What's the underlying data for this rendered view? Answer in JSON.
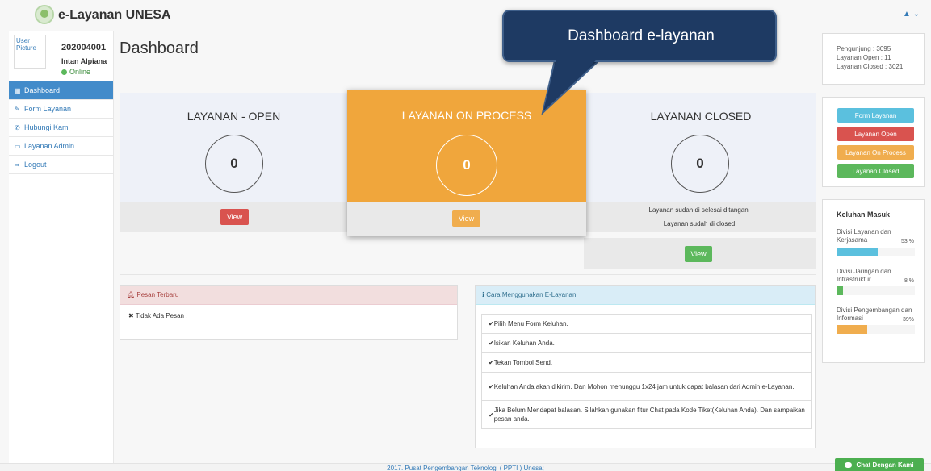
{
  "header": {
    "app_title": "e-Layanan UNESA",
    "user_menu": "▲ ⌄"
  },
  "sidebar": {
    "user_pic_alt": "User Picture",
    "user_id": "202004001",
    "user_name": "Intan Alpiana",
    "status": "Online",
    "items": [
      {
        "icon": "table-icon",
        "glyph": "▦",
        "label": "Dashboard",
        "active": true
      },
      {
        "icon": "pencil-icon",
        "glyph": "✎",
        "label": "Form Layanan"
      },
      {
        "icon": "phone-icon",
        "glyph": "✆",
        "label": "Hubungi Kami"
      },
      {
        "icon": "laptop-icon",
        "glyph": "▭",
        "label": "Layanan Admin"
      },
      {
        "icon": "logout-icon",
        "glyph": "➥",
        "label": "Logout"
      }
    ]
  },
  "main": {
    "page_title": "Dashboard",
    "stats": {
      "open": {
        "title": "LAYANAN - OPEN",
        "count": "0",
        "button": "View"
      },
      "process": {
        "title": "LAYANAN ON PROCESS",
        "count": "0",
        "button": "View"
      },
      "closed": {
        "title": "LAYANAN CLOSED",
        "count": "0",
        "button": "View",
        "note1": "Layanan sudah di selesai ditangani",
        "note2": "Layanan sudah di closed"
      }
    },
    "pesan": {
      "title": "Pesan Terbaru",
      "icon": "bell-icon",
      "empty_text": "Tidak Ada Pesan !"
    },
    "cara": {
      "title": "Cara Menggunakan E-Layanan",
      "icon": "info-icon",
      "steps": [
        "Pilih Menu Form Keluhan.",
        "Isikan Keluhan Anda.",
        "Tekan Tombol Send.",
        "Keluhan Anda akan dikirim. Dan Mohon menunggu 1x24 jam untuk dapat balasan dari Admin e-Layanan.",
        "Jika Belum Mendapat balasan. Silahkan gunakan fitur Chat pada Kode Tiket(Keluhan Anda). Dan sampaikan pesan anda."
      ]
    }
  },
  "right": {
    "info": [
      "Pengunjung : 3095",
      "Layanan Open : 11",
      "Layanan Closed : 3021"
    ],
    "buttons": [
      {
        "label": "Form Layanan",
        "style": "cyan"
      },
      {
        "label": "Layanan Open",
        "style": "red"
      },
      {
        "label": "Layanan On Process",
        "style": "orange"
      },
      {
        "label": "Layanan Closed",
        "style": "green"
      }
    ],
    "keluhan": {
      "title": "Keluhan Masuk",
      "items": [
        {
          "label": "Divisi Layanan dan Kerjasama",
          "percent_text": "53 %",
          "value": 53,
          "color": "#5bc0de"
        },
        {
          "label": "Divisi Jaringan dan Infrastruktur",
          "percent_text": "8 %",
          "value": 8,
          "color": "#5cb85c"
        },
        {
          "label": "Divisi Pengembangan dan Informasi",
          "percent_text": "39%",
          "value": 39,
          "color": "#f0ad4e"
        }
      ]
    }
  },
  "footer": {
    "text": "2017. Pusat Pengembangan Teknologi ( PPTI ) Unesa;",
    "chat_label": "Chat Dengan Kami"
  },
  "callout": {
    "text": "Dashboard e-layanan"
  },
  "colors": {
    "primary": "#428bca",
    "process": "#f0a63c",
    "callout": "#1e3a63"
  }
}
